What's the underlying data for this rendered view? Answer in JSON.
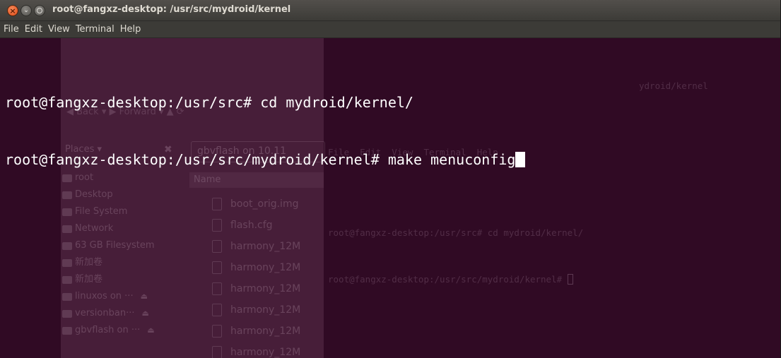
{
  "window": {
    "title": "root@fangxz-desktop: /usr/src/mydroid/kernel",
    "controls": {
      "close_icon": "×",
      "minimize_icon": "⌄"
    }
  },
  "menubar": {
    "items": [
      "File",
      "Edit",
      "View",
      "Terminal",
      "Help"
    ]
  },
  "terminal": {
    "lines": [
      "root@fangxz-desktop:/usr/src# cd mydroid/kernel/",
      "root@fangxz-desktop:/usr/src/mydroid/kernel# make menuconfig"
    ],
    "colors": {
      "background": "#300a24",
      "foreground": "#ffffff"
    }
  },
  "ghost": {
    "toolbar": "◀ Back  ▾  ▶ Forward  ▾   ▲    ⟳",
    "places_header": "Places ▾",
    "places_close": "✖",
    "path_button": "gbvflash on 10.11",
    "places": [
      {
        "label": "root",
        "eject": ""
      },
      {
        "label": "Desktop",
        "eject": ""
      },
      {
        "label": "File System",
        "eject": ""
      },
      {
        "label": "Network",
        "eject": ""
      },
      {
        "label": "63 GB Filesystem",
        "eject": ""
      },
      {
        "label": "新加卷",
        "eject": ""
      },
      {
        "label": "新加卷",
        "eject": ""
      },
      {
        "label": "linuxos on ···",
        "eject": "⏏"
      },
      {
        "label": "versionban···",
        "eject": "⏏"
      },
      {
        "label": "gbvflash on ···",
        "eject": "⏏"
      }
    ],
    "list_header": "Name",
    "files": [
      "boot_orig.img",
      "flash.cfg",
      "harmony_12M",
      "harmony_12M",
      "harmony_12M",
      "harmony_12M",
      "harmony_12M",
      "harmony_12M"
    ],
    "term_title": "ydroid/kernel",
    "term_menu": "File  Edit  View  Terminal  Help",
    "term_lines": [
      "root@fangxz-desktop:/usr/src# cd mydroid/kernel/",
      "root@fangxz-desktop:/usr/src/mydroid/kernel# "
    ]
  }
}
